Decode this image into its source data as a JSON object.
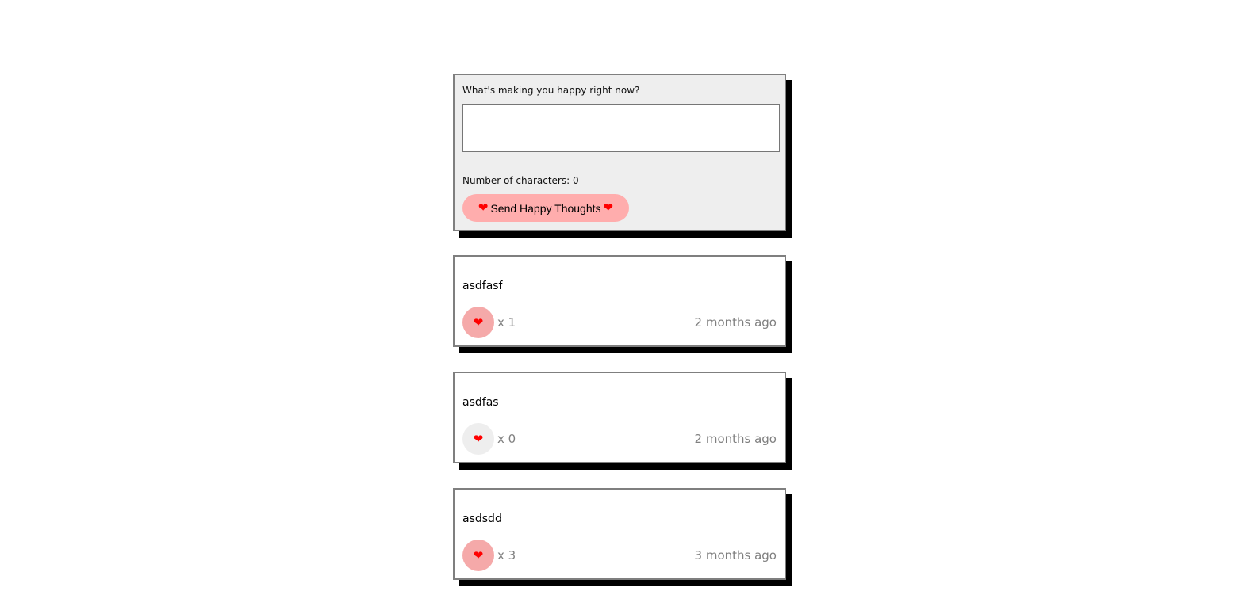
{
  "form": {
    "question": "What's making you happy right now?",
    "input_value": "",
    "char_count_label": "Number of characters: 0",
    "send_label": "Send Happy Thoughts",
    "heart_glyph": "❤"
  },
  "thoughts": [
    {
      "message": "asdfasf",
      "likes": "x 1",
      "time": "2 months ago",
      "liked": true
    },
    {
      "message": "asdfas",
      "likes": "x 0",
      "time": "2 months ago",
      "liked": false
    },
    {
      "message": "asdsdd",
      "likes": "x 3",
      "time": "3 months ago",
      "liked": true
    }
  ],
  "colors": {
    "card_border": "#7f7f7f",
    "shadow": "#000000",
    "form_background": "#eeeeee",
    "button_pink": "#ffadad",
    "heart_red": "#ff0000",
    "liked_background": "#f5a9a9",
    "unliked_background": "#eeeeee",
    "muted_text": "#7f7f7f"
  },
  "icons": {
    "heart": "heart-icon"
  }
}
